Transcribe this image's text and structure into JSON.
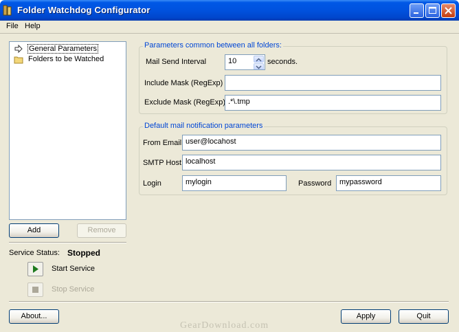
{
  "window": {
    "title": "Folder Watchdog Configurator"
  },
  "menu": {
    "file": "File",
    "help": "Help"
  },
  "tree": {
    "items": [
      {
        "label": "General Parameters",
        "icon": "arrow-icon",
        "selected": true
      },
      {
        "label": "Folders to be Watched",
        "icon": "folder-icon",
        "selected": false
      }
    ]
  },
  "left_buttons": {
    "add": "Add",
    "remove": "Remove"
  },
  "service": {
    "status_label": "Service Status:",
    "status_value": "Stopped",
    "start_label": "Start Service",
    "stop_label": "Stop Service"
  },
  "common_params": {
    "title": "Parameters common between all folders:",
    "mail_send_interval_label": "Mail Send Interval",
    "mail_send_interval_value": "10",
    "seconds_label": "seconds.",
    "include_mask_label": "Include Mask (RegExp)",
    "include_mask_value": "",
    "exclude_mask_label": "Exclude Mask (RegExp)",
    "exclude_mask_value": ".*\\.tmp"
  },
  "mail_params": {
    "title": "Default mail notification parameters",
    "from_email_label": "From Email",
    "from_email_value": "user@locahost",
    "smtp_host_label": "SMTP Host",
    "smtp_host_value": "localhost",
    "login_label": "Login",
    "login_value": "mylogin",
    "password_label": "Password",
    "password_value": "mypassword"
  },
  "bottom_buttons": {
    "about": "About...",
    "apply": "Apply",
    "quit": "Quit"
  },
  "watermark": "GearDownload.com"
}
